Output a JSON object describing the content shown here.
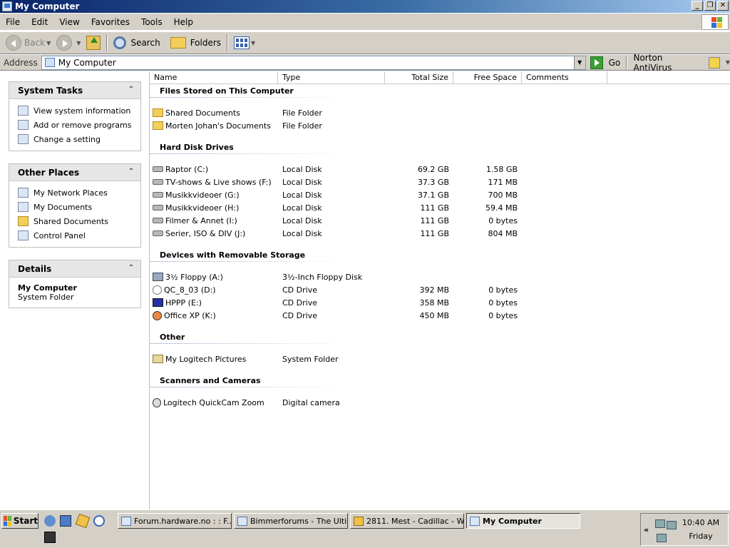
{
  "window": {
    "title": "My Computer",
    "buttons": [
      "_",
      "❐",
      "✕"
    ]
  },
  "menu": [
    "File",
    "Edit",
    "View",
    "Favorites",
    "Tools",
    "Help"
  ],
  "toolbar": {
    "back": "Back",
    "search": "Search",
    "folders": "Folders"
  },
  "address": {
    "label": "Address",
    "value": "My Computer",
    "go": "Go",
    "norton": "Norton AntiVirus"
  },
  "tasks": {
    "system_tasks": {
      "title": "System Tasks",
      "items": [
        "View system information",
        "Add or remove programs",
        "Change a setting"
      ]
    },
    "other_places": {
      "title": "Other Places",
      "items": [
        "My Network Places",
        "My Documents",
        "Shared Documents",
        "Control Panel"
      ]
    },
    "details": {
      "title": "Details",
      "name": "My Computer",
      "type": "System Folder"
    }
  },
  "columns": [
    "Name",
    "Type",
    "Total Size",
    "Free Space",
    "Comments"
  ],
  "groups": {
    "files": {
      "title": "Files Stored on This Computer",
      "items": [
        {
          "name": "Shared Documents",
          "type": "File Folder",
          "total": "",
          "free": ""
        },
        {
          "name": "Morten Johan's Documents",
          "type": "File Folder",
          "total": "",
          "free": ""
        }
      ]
    },
    "hdd": {
      "title": "Hard Disk Drives",
      "items": [
        {
          "name": "Raptor (C:)",
          "type": "Local Disk",
          "total": "69.2 GB",
          "free": "1.58 GB"
        },
        {
          "name": "TV-shows & Live shows (F:)",
          "type": "Local Disk",
          "total": "37.3 GB",
          "free": "171 MB"
        },
        {
          "name": "Musikkvideoer (G:)",
          "type": "Local Disk",
          "total": "37.1 GB",
          "free": "700 MB"
        },
        {
          "name": "Musikkvideoer (H:)",
          "type": "Local Disk",
          "total": "111 GB",
          "free": "59.4 MB"
        },
        {
          "name": "Filmer & Annet (I:)",
          "type": "Local Disk",
          "total": "111 GB",
          "free": "0 bytes"
        },
        {
          "name": "Serier, ISO & DIV (J:)",
          "type": "Local Disk",
          "total": "111 GB",
          "free": "804 MB"
        }
      ]
    },
    "removable": {
      "title": "Devices with Removable Storage",
      "items": [
        {
          "name": "3½ Floppy (A:)",
          "type": "3½-Inch Floppy Disk",
          "total": "",
          "free": ""
        },
        {
          "name": "QC_8_03 (D:)",
          "type": "CD Drive",
          "total": "392 MB",
          "free": "0 bytes"
        },
        {
          "name": "HPPP (E:)",
          "type": "CD Drive",
          "total": "358 MB",
          "free": "0 bytes"
        },
        {
          "name": "Office XP (K:)",
          "type": "CD Drive",
          "total": "450 MB",
          "free": "0 bytes"
        }
      ]
    },
    "other": {
      "title": "Other",
      "items": [
        {
          "name": "My Logitech Pictures",
          "type": "System Folder",
          "total": "",
          "free": ""
        }
      ]
    },
    "scanners": {
      "title": "Scanners and Cameras",
      "items": [
        {
          "name": "Logitech QuickCam Zoom",
          "type": "Digital camera",
          "total": "",
          "free": ""
        }
      ]
    }
  },
  "taskbar": {
    "start": "Start",
    "buttons": [
      "Forum.hardware.no : : F...",
      "Bimmerforums - The Ulti...",
      "2811. Mest - Cadillac - W...",
      "My Computer"
    ],
    "tray_arrow": "«",
    "time": "10:40 AM",
    "day": "Friday"
  }
}
